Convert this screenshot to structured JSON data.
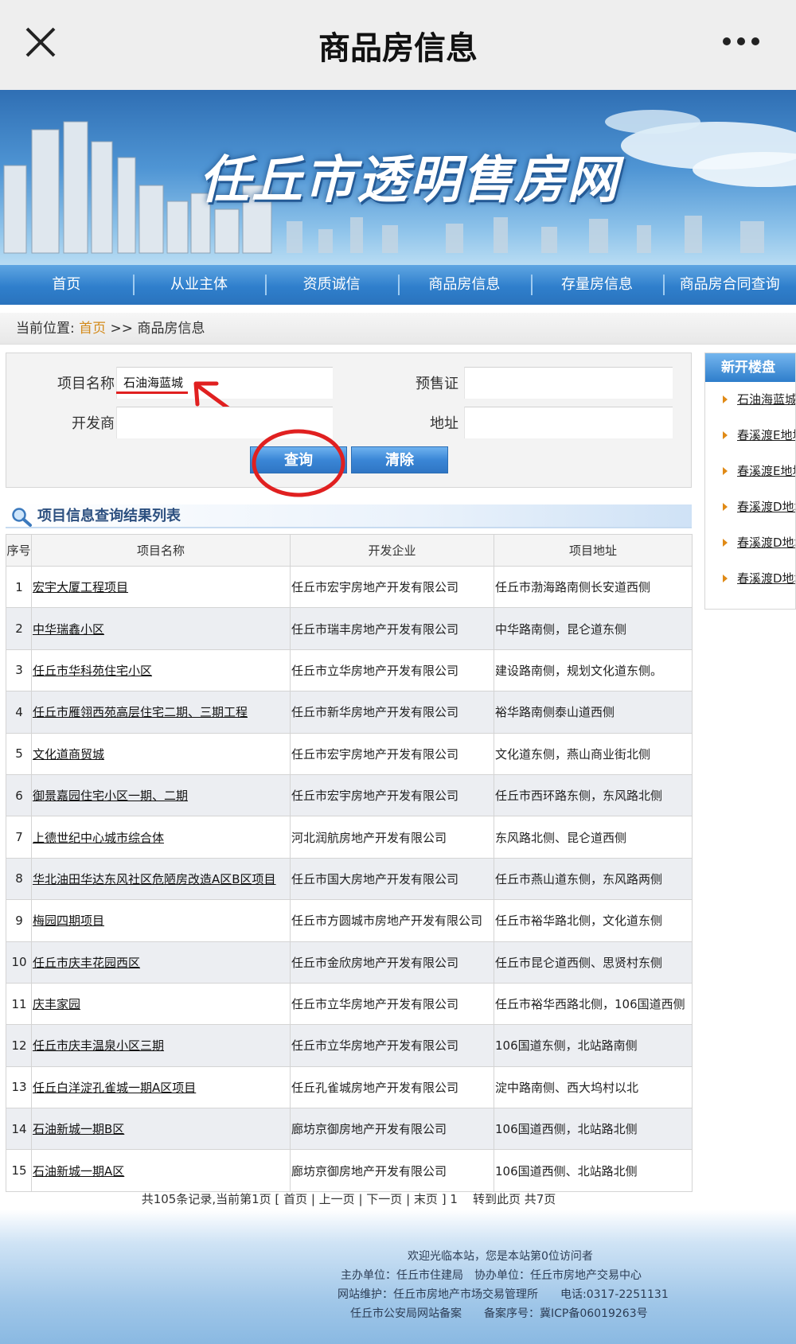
{
  "appbar": {
    "title": "商品房信息"
  },
  "banner": {
    "site_title": "任丘市透明售房网"
  },
  "nav": [
    "首页",
    "从业主体",
    "资质诚信",
    "商品房信息",
    "存量房信息",
    "商品房合同查询"
  ],
  "breadcrumb": {
    "prefix": "当前位置:",
    "home": "首页",
    "sep": ">>",
    "current": "商品房信息"
  },
  "search": {
    "project_label": "项目名称",
    "project_value": "石油海蓝城",
    "presale_label": "预售证",
    "presale_value": "",
    "developer_label": "开发商",
    "developer_value": "",
    "address_label": "地址",
    "address_value": "",
    "query_button": "查询",
    "clear_button": "清除"
  },
  "sidebar": {
    "title": "新开楼盘",
    "items": [
      "石油海蓝城",
      "春溪渡E地块",
      "春溪渡E地块",
      "春溪渡D地块",
      "春溪渡D地块",
      "春溪渡D地块"
    ]
  },
  "results": {
    "heading": "项目信息查询结果列表",
    "columns": [
      "序号",
      "项目名称",
      "开发企业",
      "项目地址"
    ],
    "rows": [
      [
        "1",
        "宏宇大厦工程项目",
        "任丘市宏宇房地产开发有限公司",
        "任丘市渤海路南侧长安道西侧"
      ],
      [
        "2",
        "中华瑞鑫小区",
        "任丘市瑞丰房地产开发有限公司",
        "中华路南侧，昆仑道东侧"
      ],
      [
        "3",
        "任丘市华科苑住宅小区",
        "任丘市立华房地产开发有限公司",
        "建设路南侧，规划文化道东侧。"
      ],
      [
        "4",
        "任丘市雁翎西苑高层住宅二期、三期工程",
        "任丘市新华房地产开发有限公司",
        "裕华路南侧泰山道西侧"
      ],
      [
        "5",
        "文化道商贸城",
        "任丘市宏宇房地产开发有限公司",
        "文化道东侧，燕山商业街北侧"
      ],
      [
        "6",
        "御景嘉园住宅小区一期、二期",
        "任丘市宏宇房地产开发有限公司",
        "任丘市西环路东侧，东风路北侧"
      ],
      [
        "7",
        "上德世纪中心城市综合体",
        "河北润航房地产开发有限公司",
        "东风路北侧、昆仑道西侧"
      ],
      [
        "8",
        "华北油田华达东风社区危陋房改造A区B区项目",
        "任丘市国大房地产开发有限公司",
        "任丘市燕山道东侧，东风路两侧"
      ],
      [
        "9",
        "梅园四期项目",
        "任丘市方圆城市房地产开发有限公司",
        "任丘市裕华路北侧，文化道东侧"
      ],
      [
        "10",
        "任丘市庆丰花园西区",
        "任丘市金欣房地产开发有限公司",
        "任丘市昆仑道西侧、思贤村东侧"
      ],
      [
        "11",
        "庆丰家园",
        "任丘市立华房地产开发有限公司",
        "任丘市裕华西路北侧，106国道西侧"
      ],
      [
        "12",
        "任丘市庆丰温泉小区三期",
        "任丘市立华房地产开发有限公司",
        "106国道东侧，北站路南侧"
      ],
      [
        "13",
        "任丘白洋淀孔雀城一期A区项目",
        "任丘孔雀城房地产开发有限公司",
        "淀中路南侧、西大坞村以北"
      ],
      [
        "14",
        "石油新城一期B区",
        "廊坊京御房地产开发有限公司",
        "106国道西侧，北站路北侧"
      ],
      [
        "15",
        "石油新城一期A区",
        "廊坊京御房地产开发有限公司",
        "106国道西侧、北站路北侧"
      ]
    ]
  },
  "pager": {
    "summary": "共105条记录,当前第1页",
    "first": "首页",
    "prev": "上一页",
    "next": "下一页",
    "last": "末页",
    "page": "1",
    "goto": "转到此页",
    "total": "共7页"
  },
  "footer": {
    "welcome": "欢迎光临本站，您是本站第0位访问者",
    "host": "主办单位：任丘市住建局　协办单位：任丘市房地产交易中心",
    "maintain": "网站维护：任丘市房地产市场交易管理所　　电话:0317-2251131",
    "record": "任丘市公安局网站备案　　备案序号：冀ICP备06019263号"
  },
  "colors": {
    "nav_blue": "#2f7fcc",
    "annotation_red": "#e02020",
    "breadcrumb_home": "#d38b1c"
  }
}
